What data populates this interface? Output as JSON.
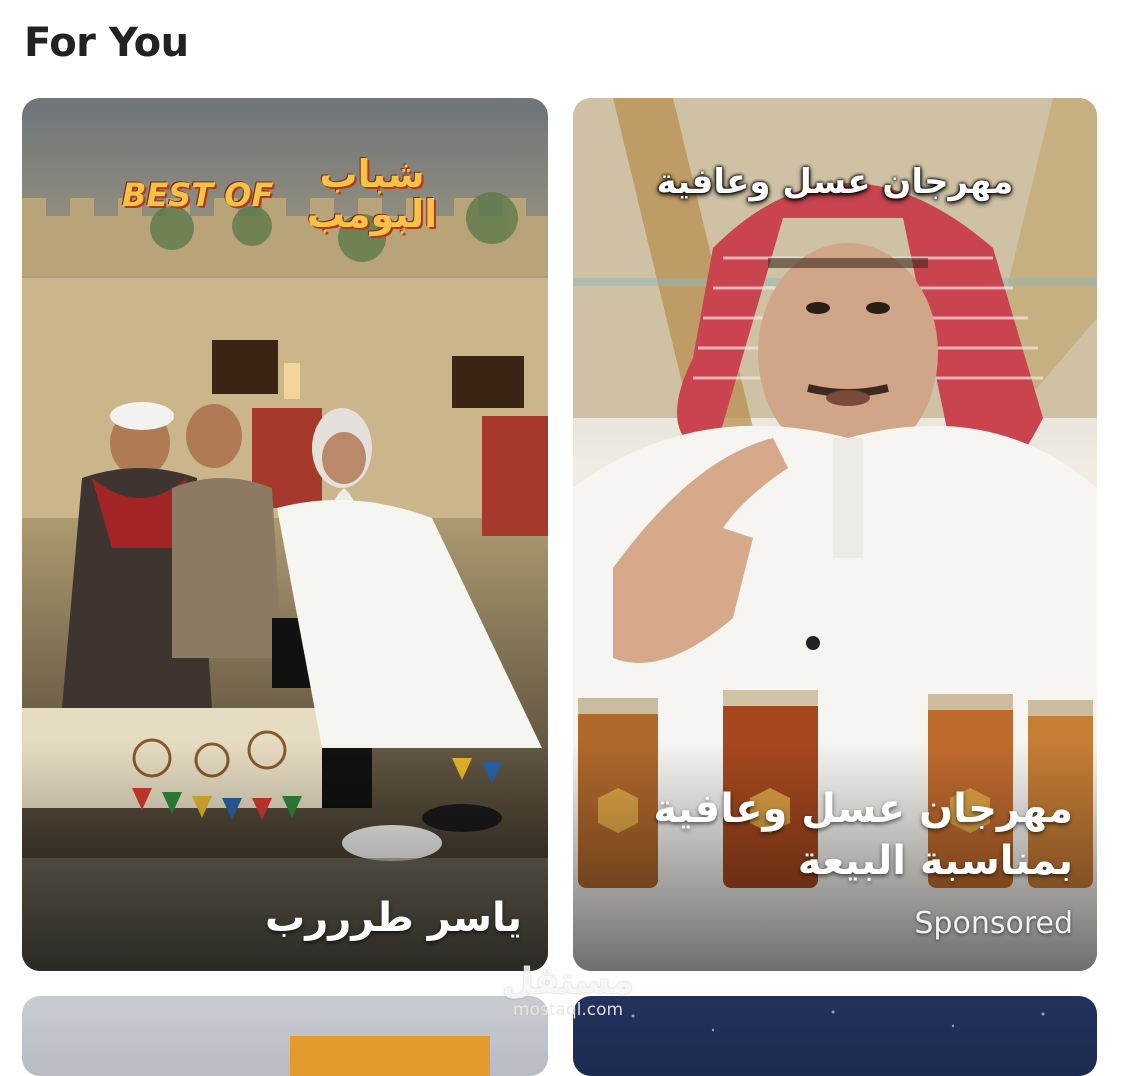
{
  "section": {
    "title": "For You"
  },
  "cards": [
    {
      "logo_en": "BEST OF",
      "logo_ar": "شباب البومب",
      "caption": "ياسر طرررب"
    },
    {
      "top_caption": "مهرجان عسل وعافية",
      "title_line1": "مهرجان عسل وعافية",
      "title_line2": "بمناسبة البيعة",
      "badge": "Sponsored"
    }
  ],
  "watermark": {
    "logo": "مستقل",
    "url": "mostaql.com"
  }
}
